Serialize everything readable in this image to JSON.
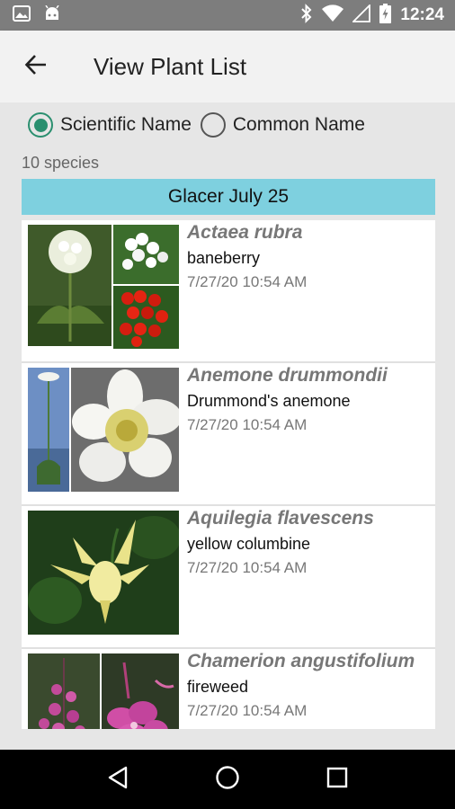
{
  "status_bar": {
    "time": "12:24",
    "icons": [
      "image-icon",
      "android-icon",
      "bluetooth-icon",
      "wifi-icon",
      "signal-icon",
      "battery-charging-icon"
    ]
  },
  "app_bar": {
    "title": "View Plant List",
    "back_icon": "arrow-back-icon"
  },
  "name_toggle": {
    "options": [
      {
        "label": "Scientific Name",
        "checked": true
      },
      {
        "label": "Common Name",
        "checked": false
      }
    ]
  },
  "species_count": "10 species",
  "list_header": "Glacer July 25",
  "plants": [
    {
      "scientific": "Actaea rubra",
      "common": "baneberry",
      "date": "7/27/20 10:54 AM"
    },
    {
      "scientific": "Anemone drummondii",
      "common": "Drummond's anemone",
      "date": "7/27/20 10:54 AM"
    },
    {
      "scientific": "Aquilegia flavescens",
      "common": "yellow columbine",
      "date": "7/27/20 10:54 AM"
    },
    {
      "scientific": "Chamerion angustifolium",
      "common": "fireweed",
      "date": "7/27/20 10:54 AM"
    }
  ],
  "nav_bar": {
    "icons": [
      "back-triangle-icon",
      "home-circle-icon",
      "recents-square-icon"
    ]
  },
  "colors": {
    "status_bar": "#7d7d7d",
    "accent": "#2a8f6f",
    "header_band": "#7ed0df"
  }
}
